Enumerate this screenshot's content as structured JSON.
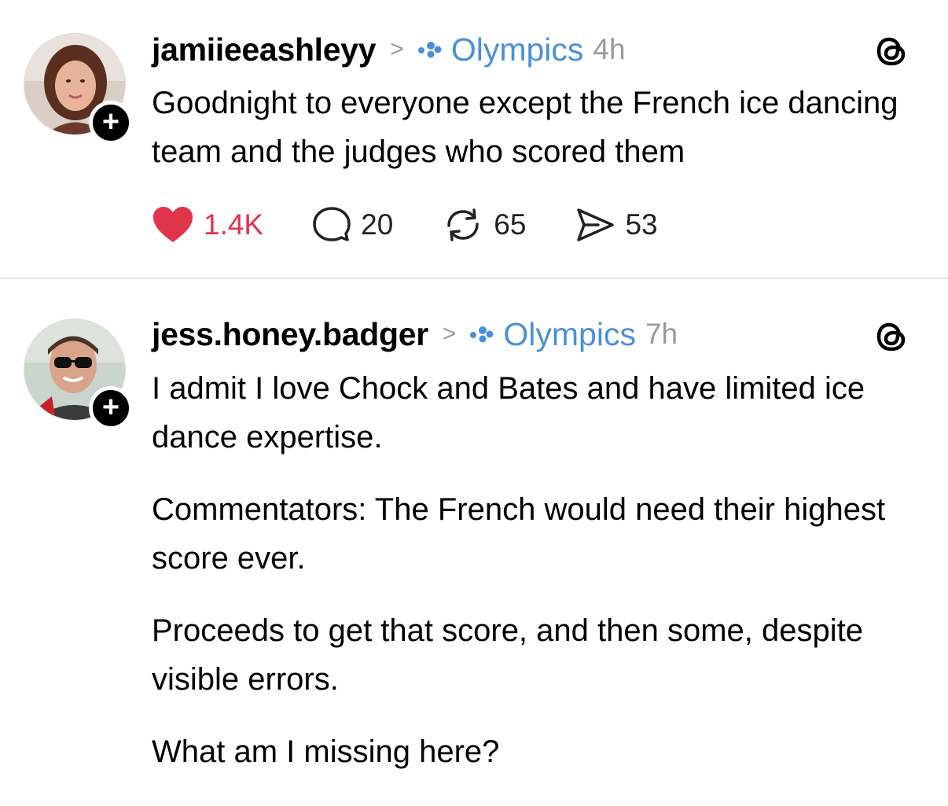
{
  "posts": [
    {
      "username": "jamiieeashleyy",
      "chevron": ">",
      "topic": "Olympics",
      "time": "4h",
      "follow_icon": "plus-icon",
      "follow_symbol": "+",
      "paragraphs": [
        "Goodnight to everyone except the French ice dancing team and the judges who scored them"
      ],
      "actions": {
        "likes": "1.4K",
        "replies": "20",
        "reposts": "65",
        "shares": "53"
      },
      "liked": true
    },
    {
      "username": "jess.honey.badger",
      "chevron": ">",
      "topic": "Olympics",
      "time": "7h",
      "follow_icon": "plus-icon",
      "follow_symbol": "+",
      "paragraphs": [
        "I admit I love Chock and Bates and have limited ice dance expertise.",
        "Commentators: The French would need their highest score ever.",
        "Proceeds to get that score, and then some, despite visible errors.",
        "What am I missing here?"
      ]
    }
  ],
  "colors": {
    "topic": "#4a90d9",
    "like": "#e0344b",
    "meta": "#9a9a9a",
    "divider": "#e6e6e6"
  },
  "icons": {
    "threads_logo": "threads-logo-icon",
    "heart": "heart-icon",
    "reply": "reply-bubble-icon",
    "repost": "repost-icon",
    "share": "share-send-icon",
    "topic": "topic-dots-icon",
    "chevron": "chevron-right-icon"
  }
}
